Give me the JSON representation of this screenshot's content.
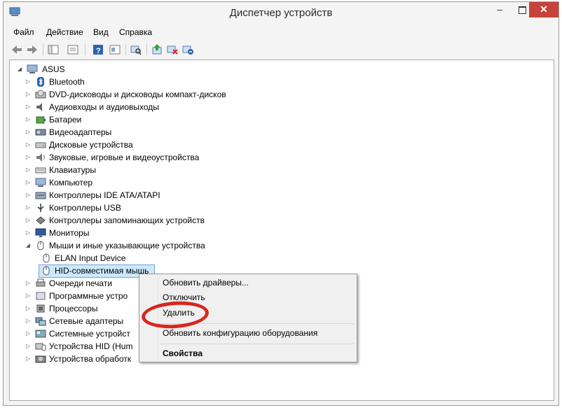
{
  "window": {
    "title": "Диспетчер устройств"
  },
  "menu": [
    "Файл",
    "Действие",
    "Вид",
    "Справка"
  ],
  "toolbar": {
    "icons": [
      "back-icon",
      "forward-icon",
      "properties-pane-icon",
      "show-hide-tree-icon",
      "help-icon",
      "console-icon",
      "scan-hardware-icon",
      "update-driver-icon",
      "disable-device-icon",
      "uninstall-device-icon"
    ]
  },
  "tree": {
    "root": "ASUS",
    "items": [
      {
        "label": "Bluetooth",
        "icon": "bluetooth-icon",
        "expanded": false
      },
      {
        "label": "DVD-дисководы и дисководы компакт-дисков",
        "icon": "dvd-drive-icon",
        "expanded": false
      },
      {
        "label": "Аудиовходы и аудиовыходы",
        "icon": "audio-icon",
        "expanded": false
      },
      {
        "label": "Батареи",
        "icon": "battery-icon",
        "expanded": false
      },
      {
        "label": "Видеоадаптеры",
        "icon": "display-adapter-icon",
        "expanded": false
      },
      {
        "label": "Дисковые устройства",
        "icon": "disk-drive-icon",
        "expanded": false
      },
      {
        "label": "Звуковые, игровые и видеоустройства",
        "icon": "sound-icon",
        "expanded": false
      },
      {
        "label": "Клавиатуры",
        "icon": "keyboard-icon",
        "expanded": false
      },
      {
        "label": "Компьютер",
        "icon": "computer-icon",
        "expanded": false
      },
      {
        "label": "Контроллеры IDE ATA/ATAPI",
        "icon": "ide-controller-icon",
        "expanded": false
      },
      {
        "label": "Контроллеры USB",
        "icon": "usb-icon",
        "expanded": false
      },
      {
        "label": "Контроллеры запоминающих устройств",
        "icon": "storage-controller-icon",
        "expanded": false
      },
      {
        "label": "Мониторы",
        "icon": "monitor-icon",
        "expanded": false
      },
      {
        "label": "Мыши и иные указывающие устройства",
        "icon": "mouse-icon",
        "expanded": true
      },
      {
        "label": "ELAN Input Device",
        "icon": "mouse-icon",
        "child": true
      },
      {
        "label": "HID-совместимая мышь",
        "icon": "mouse-icon",
        "child": true,
        "selected": true
      },
      {
        "label": "Очереди печати",
        "icon": "printer-icon",
        "expanded": false
      },
      {
        "label": "Программные устро",
        "icon": "software-device-icon",
        "expanded": false
      },
      {
        "label": "Процессоры",
        "icon": "processor-icon",
        "expanded": false
      },
      {
        "label": "Сетевые адаптеры",
        "icon": "network-icon",
        "expanded": false
      },
      {
        "label": "Системные устройст",
        "icon": "system-device-icon",
        "expanded": false
      },
      {
        "label": "Устройства HID (Hum",
        "icon": "hid-icon",
        "expanded": false
      },
      {
        "label": "Устройства обработк",
        "icon": "imaging-icon",
        "expanded": false
      }
    ]
  },
  "context_menu": {
    "update_drivers": "Обновить драйверы...",
    "disable": "Отключить",
    "uninstall": "Удалить",
    "scan": "Обновить конфигурацию оборудования",
    "properties": "Свойства"
  },
  "colors": {
    "highlight_ring": "#d8261f",
    "selection": "#cce8ff",
    "close_button": "#c7423a"
  }
}
